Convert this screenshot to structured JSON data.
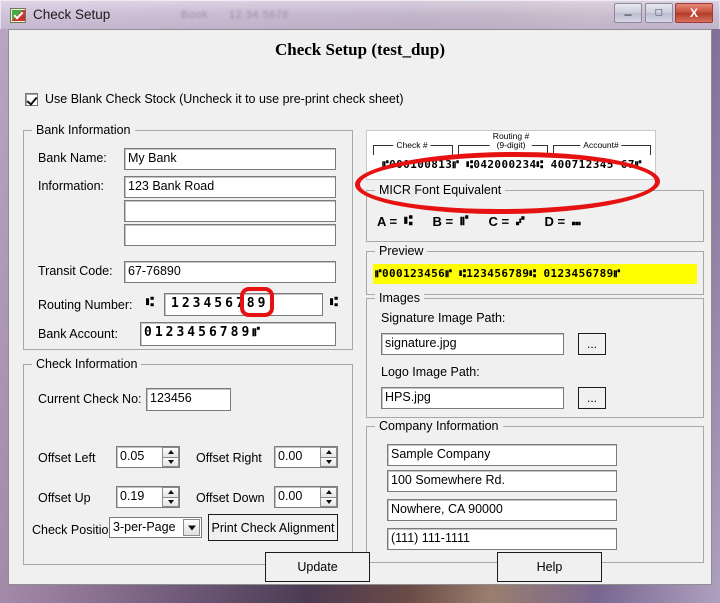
{
  "window": {
    "title": "Check Setup",
    "app_icon": "checkmark-app-icon",
    "minimize_label": "–",
    "maximize_label": "□",
    "close_label": "X",
    "ghost_text_1": "Book",
    "ghost_text_2": "12 34 5678"
  },
  "form": {
    "title": "Check Setup (test_dup)",
    "blank_stock": {
      "checked": true,
      "label": "Use Blank Check Stock (Uncheck it to use pre-print check sheet)"
    }
  },
  "bank_information": {
    "legend": "Bank Information",
    "bank_name_label": "Bank Name:",
    "bank_name_value": "My Bank",
    "information_label": "Information:",
    "information_line1": "123 Bank Road",
    "information_line2": "",
    "information_line3": "",
    "transit_code_label": "Transit Code:",
    "transit_code_value": "67-76890",
    "routing_number_label": "Routing Number:",
    "routing_number_value": "123456789",
    "routing_prefix_symbol": "⑆",
    "routing_suffix_symbol": "⑆",
    "bank_account_label": "Bank Account:",
    "bank_account_value": "0123456789",
    "bank_account_suffix_symbol": "⑈"
  },
  "check_information": {
    "legend": "Check Information",
    "current_check_no_label": "Current Check No:",
    "current_check_no_value": "123456",
    "offset_left_label": "Offset Left",
    "offset_left_value": "0.05",
    "offset_right_label": "Offset Right",
    "offset_right_value": "0.00",
    "offset_up_label": "Offset Up",
    "offset_up_value": "0.19",
    "offset_down_label": "Offset Down",
    "offset_down_value": "0.00",
    "check_position_label": "Check Position",
    "check_position_value": "3-per-Page",
    "print_alignment_label": "Print Check Alignment"
  },
  "micr_diagram": {
    "check_label": "Check #",
    "routing_label_line1": "Routing #",
    "routing_label_line2": "(9-digit)",
    "account_label": "Account#",
    "sample_line": "⑈000100813⑈ ⑆042000234⑆ 400712345 67⑈"
  },
  "micr_font_equivalent": {
    "legend": "MICR Font Equivalent",
    "entries": [
      {
        "letter": "A =",
        "symbol": "⑆"
      },
      {
        "letter": "B =",
        "symbol": "⑈"
      },
      {
        "letter": "C =",
        "symbol": "⑇"
      },
      {
        "letter": "D =",
        "symbol": "⑉"
      }
    ]
  },
  "preview": {
    "legend": "Preview",
    "line": "⑈000123456⑈ ⑆123456789⑆ 0123456789⑈",
    "highlight_color": "#ffff00"
  },
  "images": {
    "legend": "Images",
    "signature_label": "Signature Image Path:",
    "signature_value": "signature.jpg",
    "signature_browse_label": "...",
    "logo_label": "Logo Image Path:",
    "logo_value": "HPS.jpg",
    "logo_browse_label": "..."
  },
  "company_information": {
    "legend": "Company Information",
    "lines": [
      "Sample Company",
      "100 Somewhere Rd.",
      "Nowhere, CA 90000",
      "(111) 111-1111"
    ]
  },
  "actions": {
    "update_label": "Update",
    "help_label": "Help"
  },
  "annotations": {
    "accent_color": "#e61212",
    "ellipse_target": "micr-font-equivalent-group",
    "rect_target": "bank-account-onus-symbol"
  }
}
